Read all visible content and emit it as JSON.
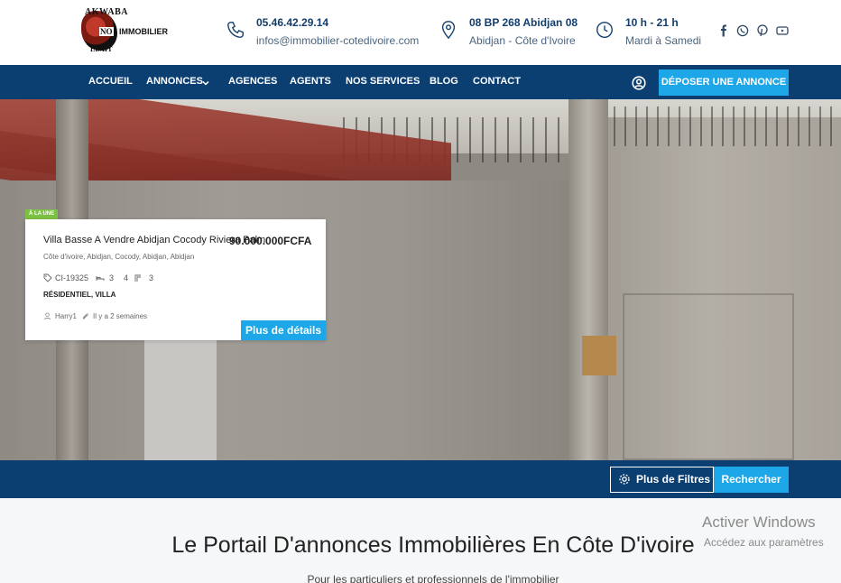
{
  "logo": {
    "line1": "AKWABA",
    "line2": "NO",
    "line3": "IMMOBILIER",
    "line4": "LIMIT"
  },
  "contacts": [
    {
      "icon": "phone-icon",
      "line1": "05.46.42.29.14",
      "line2": "infos@immobilier-cotedivoire.com"
    },
    {
      "icon": "map-pin-icon",
      "line1": "08 BP 268 Abidjan 08",
      "line2": "Abidjan - Côte d'Ivoire"
    },
    {
      "icon": "clock-icon",
      "line1": "10 h - 21 h",
      "line2": "Mardi à Samedi"
    }
  ],
  "social": [
    "facebook-icon",
    "whatsapp-icon",
    "pinterest-icon",
    "youtube-icon"
  ],
  "nav": {
    "items": [
      "Accueil",
      "Annonces",
      "Agences",
      "Agents",
      "Nos Services",
      "Blog",
      "Contact"
    ],
    "cta": "DÉPOSER UNE ANNONCE"
  },
  "listing": {
    "badge": "À LA UNE",
    "title": "Villa Basse A Vendre Abidjan Cocody Riviera Palm",
    "price": "90.000.000FCFA",
    "location": "Côte d'ivoire, Abidjan, Cocody, Abidjan, Abidjan",
    "ref": "CI-19325",
    "beds": "3",
    "baths": "4",
    "area": "3",
    "type": "RÉSIDENTIEL, VILLA",
    "author": "Harry1",
    "date": "Il y a 2 semaines",
    "details_btn": "Plus de détails"
  },
  "search": {
    "filters_btn": "Plus de Filtres",
    "search_btn": "Rechercher"
  },
  "content": {
    "headline": "Le Portail D'annonces Immobilières En Côte D'ivoire",
    "subline": "Pour les particuliers et professionnels de l'immobilier"
  },
  "watermark": {
    "line1": "Activer Windows",
    "line2": "Accédez aux paramètres"
  },
  "colors": {
    "navy": "#0b3f72",
    "accent": "#1da7e8",
    "badge": "#7cc142"
  }
}
